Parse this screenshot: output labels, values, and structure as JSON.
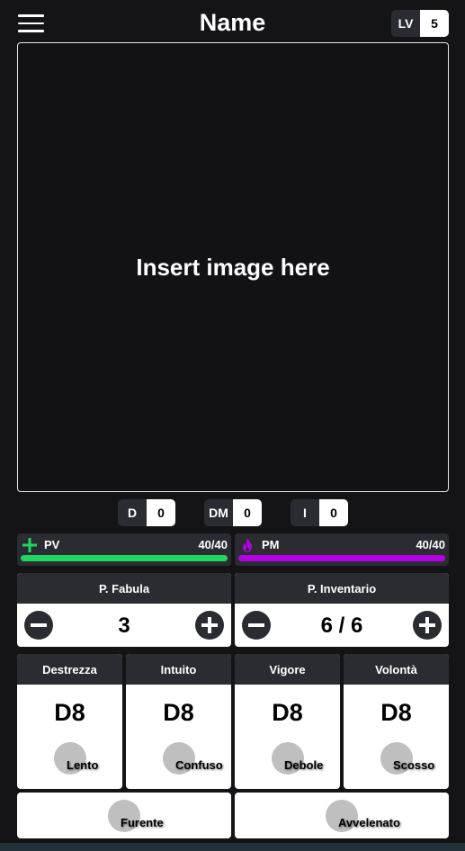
{
  "header": {
    "title": "Name",
    "level_label": "LV",
    "level_value": "5",
    "menu_icon": "hamburger-menu-icon"
  },
  "image_placeholder": "Insert image here",
  "stats": [
    {
      "label": "D",
      "value": "0"
    },
    {
      "label": "DM",
      "value": "0"
    },
    {
      "label": "I",
      "value": "0"
    }
  ],
  "bars": {
    "pv": {
      "label": "PV",
      "value": "40/40",
      "fraction": 1.0,
      "color": "#1ed760",
      "icon": "plus-icon"
    },
    "pm": {
      "label": "PM",
      "value": "40/40",
      "fraction": 1.0,
      "color": "#b300e6",
      "icon": "flame-icon"
    }
  },
  "counters": {
    "fabula": {
      "title": "P. Fabula",
      "value": "3"
    },
    "inventario": {
      "title": "P. Inventario",
      "value": "6 / 6"
    }
  },
  "attributes": [
    {
      "name": "Destrezza",
      "die": "D8",
      "status": "Lento"
    },
    {
      "name": "Intuito",
      "die": "D8",
      "status": "Confuso"
    },
    {
      "name": "Vigore",
      "die": "D8",
      "status": "Debole"
    },
    {
      "name": "Volontà",
      "die": "D8",
      "status": "Scosso"
    }
  ],
  "extra_status": {
    "left": "Furente",
    "right": "Avvelenato"
  }
}
